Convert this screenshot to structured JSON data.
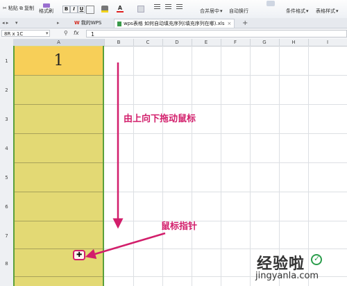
{
  "ribbon": {
    "paste": "粘贴",
    "copy": "复制",
    "format_painter": "格式刷",
    "merge_center": "合并居中",
    "wrap_text": "自动换行",
    "conditional_format": "条件格式",
    "table_style": "表格样式",
    "bold": "B",
    "italic": "I",
    "underline": "U"
  },
  "tabs": {
    "my_wps": "我的WPS",
    "document": "wps表格 如何自动填充序列(填充序列在哪).xls",
    "add": "+"
  },
  "formula_bar": {
    "name_box": "8R x 1C",
    "fx": "fx",
    "value": "1"
  },
  "columns": [
    "A",
    "B",
    "C",
    "D",
    "E",
    "F",
    "G",
    "H",
    "I"
  ],
  "rows": [
    "1",
    "2",
    "3",
    "4",
    "5",
    "6",
    "7",
    "8"
  ],
  "cell_a1": "1",
  "annotations": {
    "drag": "由上向下拖动鼠标",
    "pointer": "鼠标指针"
  },
  "watermark": {
    "text": "经验啦",
    "url": "jingyanla.com"
  },
  "colors": {
    "selection": "#e3d974",
    "active_cell": "#f7cf58",
    "border": "#5aa03c",
    "annotation": "#d21e6b"
  }
}
